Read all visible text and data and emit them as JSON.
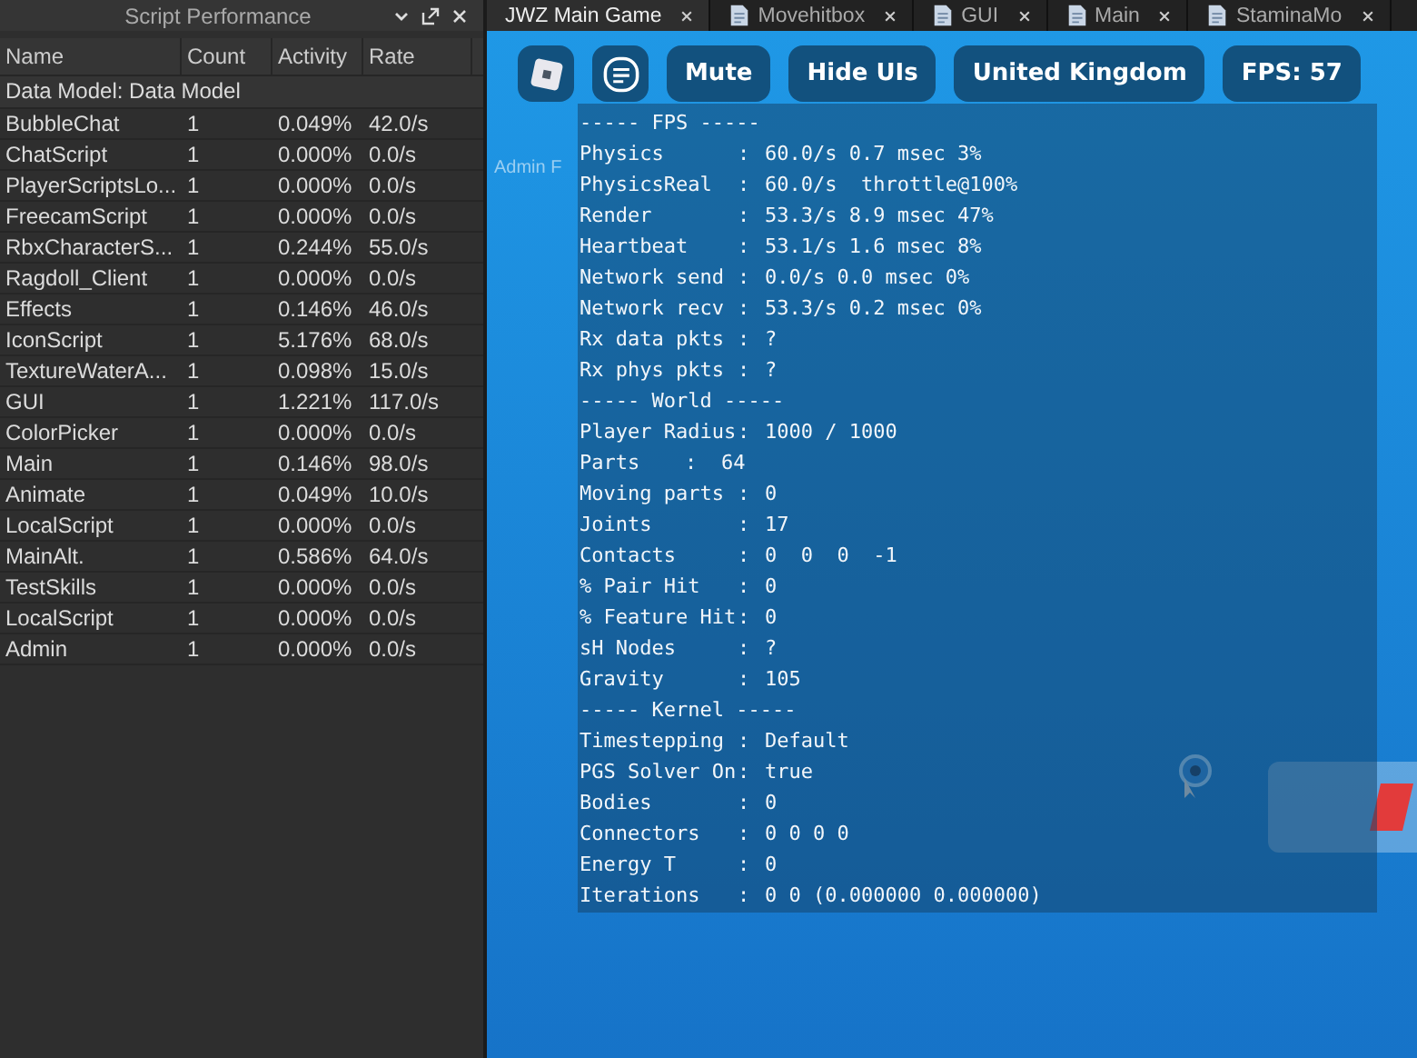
{
  "panel": {
    "title": "Script Performance",
    "columns": [
      "Name",
      "Count",
      "Activity",
      "Rate"
    ],
    "group": "Data Model: Data Model",
    "rows": [
      {
        "name": "BubbleChat",
        "count": "1",
        "activity": "0.049%",
        "rate": "42.0/s"
      },
      {
        "name": "ChatScript",
        "count": "1",
        "activity": "0.000%",
        "rate": "0.0/s"
      },
      {
        "name": "PlayerScriptsLo...",
        "count": "1",
        "activity": "0.000%",
        "rate": "0.0/s"
      },
      {
        "name": "FreecamScript",
        "count": "1",
        "activity": "0.000%",
        "rate": "0.0/s"
      },
      {
        "name": "RbxCharacterS...",
        "count": "1",
        "activity": "0.244%",
        "rate": "55.0/s"
      },
      {
        "name": "Ragdoll_Client",
        "count": "1",
        "activity": "0.000%",
        "rate": "0.0/s"
      },
      {
        "name": "Effects",
        "count": "1",
        "activity": "0.146%",
        "rate": "46.0/s"
      },
      {
        "name": "IconScript",
        "count": "1",
        "activity": "5.176%",
        "rate": "68.0/s"
      },
      {
        "name": "TextureWaterA...",
        "count": "1",
        "activity": "0.098%",
        "rate": "15.0/s"
      },
      {
        "name": "GUI",
        "count": "1",
        "activity": "1.221%",
        "rate": "117.0/s"
      },
      {
        "name": "ColorPicker",
        "count": "1",
        "activity": "0.000%",
        "rate": "0.0/s"
      },
      {
        "name": "Main",
        "count": "1",
        "activity": "0.146%",
        "rate": "98.0/s"
      },
      {
        "name": "Animate",
        "count": "1",
        "activity": "0.049%",
        "rate": "10.0/s"
      },
      {
        "name": "LocalScript",
        "count": "1",
        "activity": "0.000%",
        "rate": "0.0/s"
      },
      {
        "name": "MainAlt.",
        "count": "1",
        "activity": "0.586%",
        "rate": "64.0/s"
      },
      {
        "name": "TestSkills",
        "count": "1",
        "activity": "0.000%",
        "rate": "0.0/s"
      },
      {
        "name": "LocalScript",
        "count": "1",
        "activity": "0.000%",
        "rate": "0.0/s"
      },
      {
        "name": "Admin",
        "count": "1",
        "activity": "0.000%",
        "rate": "0.0/s"
      }
    ]
  },
  "tabs": [
    {
      "label": "JWZ Main Game",
      "selected": true,
      "has_icon": false
    },
    {
      "label": "Movehitbox",
      "selected": false,
      "has_icon": true
    },
    {
      "label": "GUI",
      "selected": false,
      "has_icon": true
    },
    {
      "label": "Main",
      "selected": false,
      "has_icon": true
    },
    {
      "label": "StaminaMo",
      "selected": false,
      "has_icon": true
    }
  ],
  "game": {
    "buttons": [
      {
        "kind": "logo"
      },
      {
        "kind": "chat"
      },
      {
        "kind": "text",
        "label": "Mute"
      },
      {
        "kind": "text",
        "label": "Hide UIs"
      },
      {
        "kind": "text",
        "label": "United Kingdom"
      },
      {
        "kind": "text",
        "label": "FPS: 57"
      }
    ],
    "faint_label": "Admin F",
    "stats": [
      {
        "kind": "section",
        "text": "----- FPS -----"
      },
      {
        "kind": "stat",
        "label": "Physics",
        "sep": ":",
        "value": "60.0/s 0.7 msec 3%"
      },
      {
        "kind": "stat",
        "label": "PhysicsReal",
        "sep": ":",
        "value": "60.0/s  throttle@100%"
      },
      {
        "kind": "stat",
        "label": "Render",
        "sep": ":",
        "value": "53.3/s 8.9 msec 47%"
      },
      {
        "kind": "stat",
        "label": "Heartbeat",
        "sep": ":",
        "value": "53.1/s 1.6 msec 8%"
      },
      {
        "kind": "stat",
        "label": "Network send",
        "sep": ":",
        "value": "0.0/s 0.0 msec 0%"
      },
      {
        "kind": "stat",
        "label": "Network recv",
        "sep": ":",
        "value": "53.3/s 0.2 msec 0%"
      },
      {
        "kind": "stat",
        "label": "Rx data pkts",
        "sep": ":",
        "value": "?"
      },
      {
        "kind": "stat",
        "label": "Rx phys pkts",
        "sep": ":",
        "value": "?"
      },
      {
        "kind": "section",
        "text": "----- World -----"
      },
      {
        "kind": "stat",
        "label": "Player Radius",
        "sep": ":",
        "value": "1000 / 1000"
      },
      {
        "kind": "inline",
        "label": "Parts",
        "sep": ":",
        "value": "64"
      },
      {
        "kind": "stat",
        "label": "Moving parts",
        "sep": ":",
        "value": "0"
      },
      {
        "kind": "stat",
        "label": "Joints",
        "sep": ":",
        "value": "17"
      },
      {
        "kind": "stat",
        "label": "Contacts",
        "sep": ":",
        "value": "0  0  0  -1"
      },
      {
        "kind": "stat",
        "label": "% Pair Hit",
        "sep": ":",
        "value": "0"
      },
      {
        "kind": "stat",
        "label": "% Feature Hit",
        "sep": ":",
        "value": "0"
      },
      {
        "kind": "stat",
        "label": "sH Nodes",
        "sep": ":",
        "value": "?"
      },
      {
        "kind": "stat",
        "label": "Gravity",
        "sep": ":",
        "value": "105"
      },
      {
        "kind": "section",
        "text": "----- Kernel -----"
      },
      {
        "kind": "stat",
        "label": "Timestepping",
        "sep": ":",
        "value": "Default"
      },
      {
        "kind": "stat",
        "label": "PGS Solver On",
        "sep": ":",
        "value": "true"
      },
      {
        "kind": "stat",
        "label": "Bodies",
        "sep": ":",
        "value": "0"
      },
      {
        "kind": "stat",
        "label": "Connectors",
        "sep": ":",
        "value": "0 0 0 0"
      },
      {
        "kind": "stat",
        "label": "Energy T",
        "sep": ":",
        "value": "0"
      },
      {
        "kind": "stat",
        "label": "Iterations",
        "sep": ":",
        "value": "0 0 (0.000000 0.000000)"
      }
    ]
  }
}
